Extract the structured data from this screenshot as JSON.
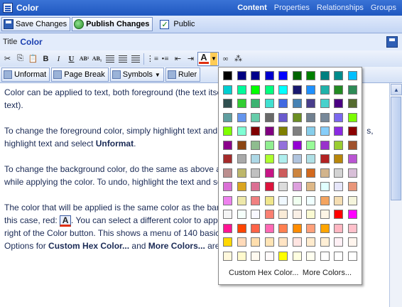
{
  "window": {
    "title": "Color"
  },
  "nav_tabs": [
    "Content",
    "Properties",
    "Relationships",
    "Groups"
  ],
  "actionbar": {
    "save_label": "Save Changes",
    "publish_label": "Publish Changes",
    "public_label": "Public",
    "public_checked": true
  },
  "title_field": {
    "label": "Title",
    "value": "Color"
  },
  "format_toolbar": {
    "bold": "B",
    "italic": "I",
    "underline": "U",
    "superscript": "AB¹",
    "subscript": "AB₁",
    "font_color": "A"
  },
  "insert_toolbar": {
    "unformat_label": "Unformat",
    "pagebreak_label": "Page Break",
    "symbols_label": "Symbols",
    "ruler_label": "Ruler"
  },
  "content": {
    "p1a": "Color can be applied to text, both foreground (the text itself) and background (behind the",
    "p1b": "text).",
    "p2a": "To change the foreground color, simply highlight text and h",
    "p2b": "s,",
    "p2c": "highlight text and select ",
    "p2c_bold": "Unformat",
    "p2c_end": ".",
    "p3a": "To change the background color, do the same as above as",
    "p3b": "while applying the color. To undo, highlight the text and sel",
    "p4a": "The color that will be applied is the same color as the bar u",
    "p4b": "this case, red: ",
    "p4b_icon": "A",
    "p4b_end": ". You can select a different color to apply",
    "p4c": "right of the Color button. This shows a menu of 140 basic c",
    "p4d": "Options for ",
    "p4d_bold1": "Custom Hex Color...",
    "p4d_mid": " and ",
    "p4d_bold2": "More Colors...",
    "p4d_end": " are a"
  },
  "palette": {
    "colors": [
      "#000000",
      "#000080",
      "#00008B",
      "#0000CD",
      "#0000FF",
      "#006400",
      "#008000",
      "#008080",
      "#008B8B",
      "#00BFFF",
      "#00CED1",
      "#00FA9A",
      "#00FF00",
      "#00FF7F",
      "#00FFFF",
      "#191970",
      "#1E90FF",
      "#20B2AA",
      "#228B22",
      "#2E8B57",
      "#2F4F4F",
      "#32CD32",
      "#3CB371",
      "#40E0D0",
      "#4169E1",
      "#4682B4",
      "#483D8B",
      "#48D1CC",
      "#4B0082",
      "#556B2F",
      "#5F9EA0",
      "#6495ED",
      "#66CDAA",
      "#696969",
      "#6A5ACD",
      "#6B8E23",
      "#708090",
      "#778899",
      "#7B68EE",
      "#7CFC00",
      "#7FFF00",
      "#7FFFD4",
      "#800000",
      "#800080",
      "#808000",
      "#808080",
      "#87CEEB",
      "#87CEFA",
      "#8A2BE2",
      "#8B0000",
      "#8B008B",
      "#8B4513",
      "#8FBC8F",
      "#90EE90",
      "#9370DB",
      "#9400D3",
      "#98FB98",
      "#9932CC",
      "#9ACD32",
      "#A0522D",
      "#A52A2A",
      "#A9A9A9",
      "#ADD8E6",
      "#ADFF2F",
      "#AFEEEE",
      "#B0C4DE",
      "#B0E0E6",
      "#B22222",
      "#B8860B",
      "#BA55D3",
      "#BC8F8F",
      "#BDB76B",
      "#C0C0C0",
      "#C71585",
      "#CD5C5C",
      "#CD853F",
      "#D2691E",
      "#D2B48C",
      "#D3D3D3",
      "#D8BFD8",
      "#DA70D6",
      "#DAA520",
      "#DB7093",
      "#DC143C",
      "#DCDCDC",
      "#DDA0DD",
      "#DEB887",
      "#E0FFFF",
      "#E6E6FA",
      "#E9967A",
      "#EE82EE",
      "#EEE8AA",
      "#F08080",
      "#F0E68C",
      "#F0F8FF",
      "#F0FFF0",
      "#F0FFFF",
      "#F4A460",
      "#F5DEB3",
      "#F5F5DC",
      "#F5F5F5",
      "#F5FFFA",
      "#F8F8FF",
      "#FA8072",
      "#FAEBD7",
      "#FAF0E6",
      "#FAFAD2",
      "#FDF5E6",
      "#FF0000",
      "#FF00FF",
      "#FF1493",
      "#FF4500",
      "#FF6347",
      "#FF69B4",
      "#FF7F50",
      "#FF8C00",
      "#FFA07A",
      "#FFA500",
      "#FFB6C1",
      "#FFC0CB",
      "#FFD700",
      "#FFDAB9",
      "#FFDEAD",
      "#FFE4B5",
      "#FFE4C4",
      "#FFE4E1",
      "#FFEBCD",
      "#FFEFD5",
      "#FFF0F5",
      "#FFF5EE",
      "#FFF8DC",
      "#FFFACD",
      "#FFFAF0",
      "#FFFAFA",
      "#FFFF00",
      "#FFFFE0",
      "#FFFFF0",
      "#FFFFFF",
      "#FFFFFF",
      "#FFFFFF"
    ],
    "custom_hex_label": "Custom Hex Color...",
    "more_colors_label": "More Colors..."
  }
}
